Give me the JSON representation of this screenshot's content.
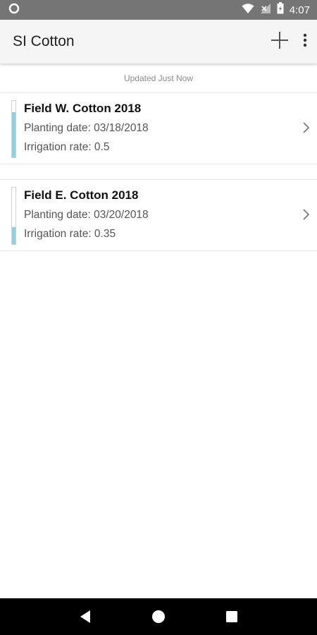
{
  "status_bar": {
    "time": "4:07",
    "icons": [
      "app-circle-icon",
      "wifi-icon",
      "signal-icon",
      "battery-icon"
    ]
  },
  "app_bar": {
    "title": "SI Cotton",
    "actions": [
      "add-icon",
      "overflow-menu-icon"
    ]
  },
  "updated_text": "Updated Just Now",
  "fields": [
    {
      "name": "Field W. Cotton 2018",
      "planting": "Planting date: 03/18/2018",
      "irrigation": "Irrigation rate: 0.5",
      "level_fraction": 0.8
    },
    {
      "name": "Field E. Cotton 2018",
      "planting": "Planting date: 03/20/2018",
      "irrigation": "Irrigation rate: 0.35",
      "level_fraction": 0.3
    }
  ],
  "colors": {
    "status_bar": "#757575",
    "app_bar": "#f5f5f5",
    "level_fill": "#7fd6f0",
    "nav_bar": "#000000"
  },
  "nav_bar": [
    "back-icon",
    "home-icon",
    "recents-icon"
  ]
}
